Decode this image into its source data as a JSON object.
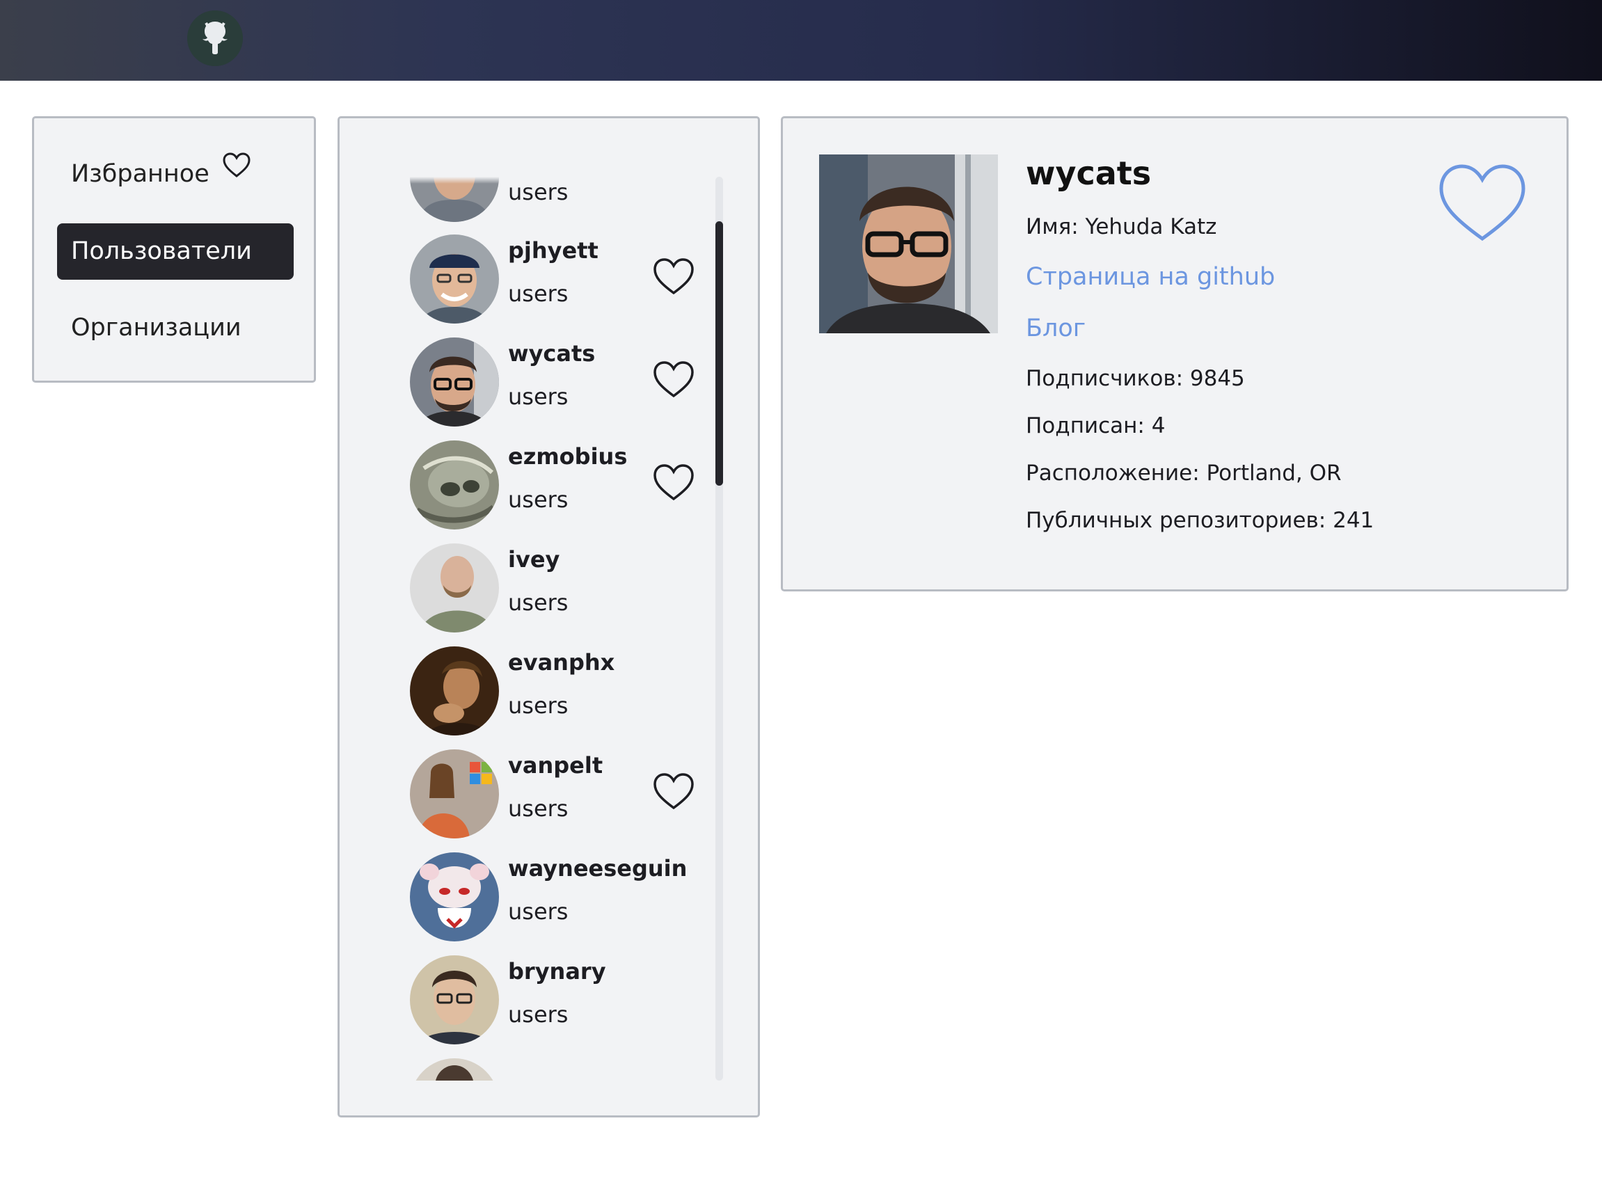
{
  "header": {
    "logo_icon": "github-octocat-icon"
  },
  "nav": {
    "items": [
      {
        "label": "Избранное",
        "icon": "heart-outline-icon",
        "active": false
      },
      {
        "label": "Пользователи",
        "active": true
      },
      {
        "label": "Организации",
        "active": false
      }
    ]
  },
  "list": {
    "partial_top": {
      "type": "users"
    },
    "items": [
      {
        "login": "pjhyett",
        "type": "users",
        "favorite": true
      },
      {
        "login": "wycats",
        "type": "users",
        "favorite": true
      },
      {
        "login": "ezmobius",
        "type": "users",
        "favorite": true
      },
      {
        "login": "ivey",
        "type": "users",
        "favorite": false
      },
      {
        "login": "evanphx",
        "type": "users",
        "favorite": false
      },
      {
        "login": "vanpelt",
        "type": "users",
        "favorite": true
      },
      {
        "login": "wayneeseguin",
        "type": "users",
        "favorite": false
      },
      {
        "login": "brynary",
        "type": "users",
        "favorite": false
      }
    ]
  },
  "detail": {
    "login": "wycats",
    "name_line": "Имя: Yehuda Katz",
    "github_link": "Страница на github",
    "blog_link": "Блог",
    "followers_line": "Подписчиков: 9845",
    "following_line": "Подписан: 4",
    "location_line": "Расположение: Portland, OR",
    "repos_line": "Публичных репозиториев: 241"
  },
  "colors": {
    "link": "#6c96e0",
    "active_nav": "#25252b",
    "card_bg": "#f2f3f5",
    "card_border": "#b8bcc3",
    "big_heart": "#6c96e0"
  }
}
